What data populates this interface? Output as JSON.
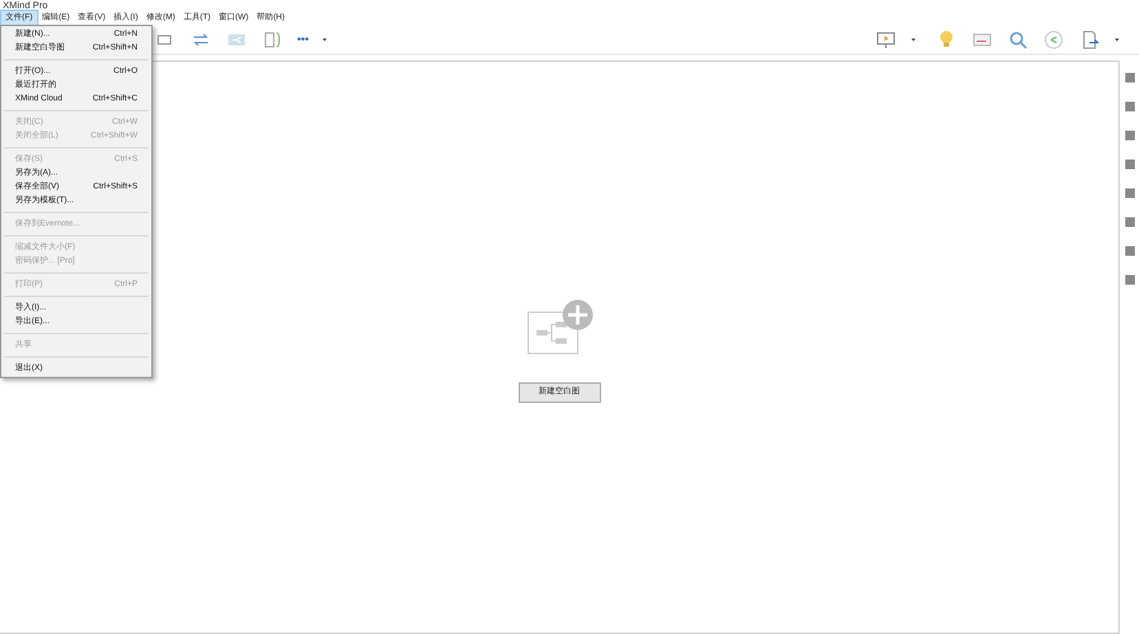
{
  "window": {
    "title": "XMind Pro"
  },
  "menubar": [
    {
      "label": "文件(F)",
      "selected": true
    },
    {
      "label": "编辑(E)",
      "selected": false
    },
    {
      "label": "查看(V)",
      "selected": false
    },
    {
      "label": "插入(I)",
      "selected": false
    },
    {
      "label": "修改(M)",
      "selected": false
    },
    {
      "label": "工具(T)",
      "selected": false
    },
    {
      "label": "窗口(W)",
      "selected": false
    },
    {
      "label": "帮助(H)",
      "selected": false
    }
  ],
  "file_menu": [
    {
      "kind": "item",
      "label": "新建(N)...",
      "shortcut": "Ctrl+N",
      "disabled": false
    },
    {
      "kind": "item",
      "label": "新建空白导图",
      "shortcut": "Ctrl+Shift+N",
      "disabled": false
    },
    {
      "kind": "separator"
    },
    {
      "kind": "item",
      "label": "打开(O)...",
      "shortcut": "Ctrl+O",
      "disabled": false
    },
    {
      "kind": "submenu",
      "label": "最近打开的",
      "disabled": false
    },
    {
      "kind": "item",
      "label": "XMind Cloud",
      "shortcut": "Ctrl+Shift+C",
      "disabled": false
    },
    {
      "kind": "separator"
    },
    {
      "kind": "item",
      "label": "关闭(C)",
      "shortcut": "Ctrl+W",
      "disabled": true
    },
    {
      "kind": "item",
      "label": "关闭全部(L)",
      "shortcut": "Ctrl+Shift+W",
      "disabled": true
    },
    {
      "kind": "separator"
    },
    {
      "kind": "item",
      "label": "保存(S)",
      "shortcut": "Ctrl+S",
      "disabled": true
    },
    {
      "kind": "item",
      "label": "另存为(A)...",
      "disabled": false
    },
    {
      "kind": "item",
      "label": "保存全部(V)",
      "shortcut": "Ctrl+Shift+S",
      "disabled": false
    },
    {
      "kind": "item",
      "label": "另存为模板(T)...",
      "disabled": false
    },
    {
      "kind": "separator"
    },
    {
      "kind": "item",
      "label": "保存到Evernote...",
      "disabled": true
    },
    {
      "kind": "separator"
    },
    {
      "kind": "item",
      "label": "缩减文件大小(F)",
      "disabled": true
    },
    {
      "kind": "item",
      "label": "密码保护... [Pro]",
      "disabled": true
    },
    {
      "kind": "separator"
    },
    {
      "kind": "item",
      "label": "打印(P)",
      "shortcut": "Ctrl+P",
      "disabled": true
    },
    {
      "kind": "separator"
    },
    {
      "kind": "item",
      "label": "导入(I)...",
      "disabled": false
    },
    {
      "kind": "item",
      "label": "导出(E)...",
      "disabled": false
    },
    {
      "kind": "separator"
    },
    {
      "kind": "item",
      "label": "共享",
      "disabled": true
    },
    {
      "kind": "separator"
    },
    {
      "kind": "item",
      "label": "退出(X)",
      "disabled": false
    }
  ],
  "toolbar": {
    "more": "•••"
  },
  "canvas": {
    "new_button": "新建空白图"
  }
}
